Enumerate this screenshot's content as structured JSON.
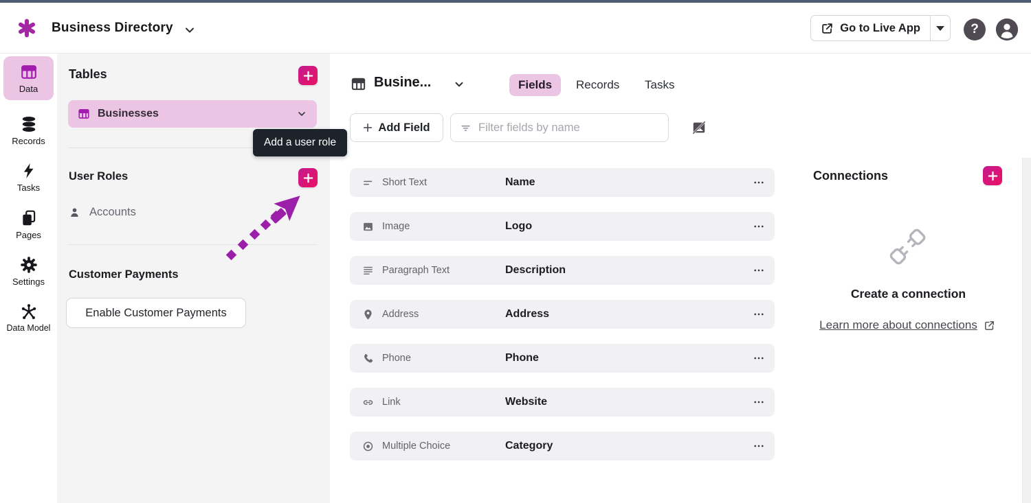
{
  "app": {
    "title": "Business Directory"
  },
  "topbar": {
    "go_to_live_app": "Go to Live App",
    "help": "?"
  },
  "sidebar": {
    "items": [
      {
        "label": "Data",
        "active": true
      },
      {
        "label": "Records",
        "active": false
      },
      {
        "label": "Tasks",
        "active": false
      },
      {
        "label": "Pages",
        "active": false
      },
      {
        "label": "Settings",
        "active": false
      },
      {
        "label": "Data Model",
        "active": false
      }
    ]
  },
  "tables_panel": {
    "tables_heading": "Tables",
    "table_item": "Businesses",
    "user_roles_heading": "User Roles",
    "accounts_item": "Accounts",
    "customer_payments_heading": "Customer Payments",
    "enable_button": "Enable Customer Payments",
    "tooltip": "Add a user role"
  },
  "main": {
    "table_title": "Busine...",
    "tabs": [
      {
        "label": "Fields",
        "active": true
      },
      {
        "label": "Records",
        "active": false
      },
      {
        "label": "Tasks",
        "active": false
      }
    ],
    "add_field": "Add Field",
    "filter_placeholder": "Filter fields by name",
    "fields": [
      {
        "type": "Short Text",
        "name": "Name"
      },
      {
        "type": "Image",
        "name": "Logo"
      },
      {
        "type": "Paragraph Text",
        "name": "Description"
      },
      {
        "type": "Address",
        "name": "Address"
      },
      {
        "type": "Phone",
        "name": "Phone"
      },
      {
        "type": "Link",
        "name": "Website"
      },
      {
        "type": "Multiple Choice",
        "name": "Category"
      }
    ]
  },
  "connections": {
    "heading": "Connections",
    "empty_title": "Create a connection",
    "learn_more": "Learn more about connections"
  },
  "colors": {
    "accent_magenta": "#a21caf",
    "pink_highlight": "#ecc5e4",
    "plus_gradient_start": "#c41a8f",
    "plus_gradient_end": "#ea1262",
    "tooltip_bg": "#1c232b",
    "annotation_purple": "#9b1fa8",
    "top_strip": "#4e5d74"
  }
}
